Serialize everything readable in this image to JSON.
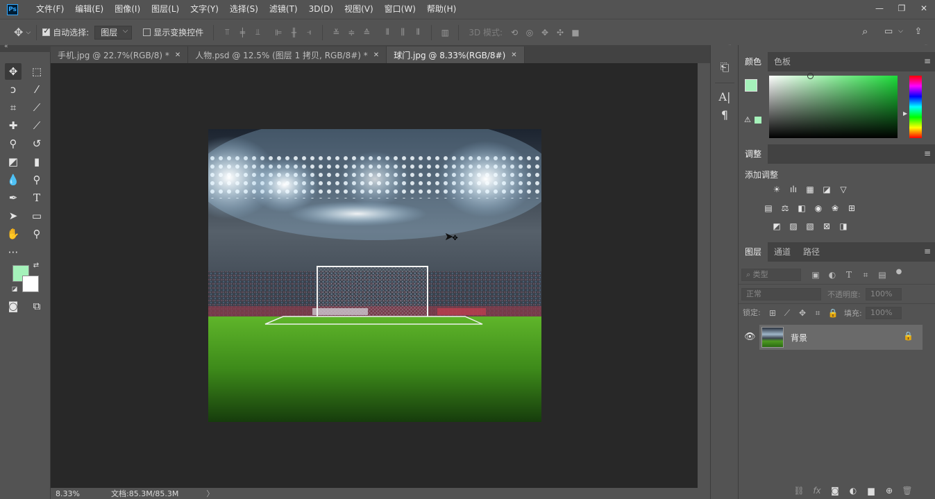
{
  "app": {
    "logo_text": "Ps",
    "menu": [
      "文件(F)",
      "编辑(E)",
      "图像(I)",
      "图层(L)",
      "文字(Y)",
      "选择(S)",
      "滤镜(T)",
      "3D(D)",
      "视图(V)",
      "窗口(W)",
      "帮助(H)"
    ],
    "window_controls": [
      "minimize-icon",
      "restore-icon",
      "close-icon"
    ]
  },
  "options": {
    "auto_select_label": "自动选择:",
    "auto_select_checked": true,
    "auto_select_target": "图层",
    "show_transform_label": "显示变换控件",
    "show_transform_checked": false,
    "mode_3d_label": "3D 模式:"
  },
  "tabs": [
    {
      "label": "手机.jpg @ 22.7%(RGB/8) *",
      "active": false
    },
    {
      "label": "人物.psd @ 12.5% (图层 1 拷贝, RGB/8#) *",
      "active": false
    },
    {
      "label": "球门.jpg @ 8.33%(RGB/8#)",
      "active": true
    }
  ],
  "status": {
    "zoom": "8.33%",
    "doc_size": "文档:85.3M/85.3M",
    "arrow": "〉"
  },
  "colors": {
    "foreground": "#a5f2ba",
    "background": "#ffffff"
  },
  "color_panel": {
    "tabs": [
      "颜色",
      "色板"
    ],
    "active_tab": "颜色"
  },
  "adjust_panel": {
    "tab": "调整",
    "title": "添加调整"
  },
  "layers_panel": {
    "tabs": [
      "图层",
      "通道",
      "路径"
    ],
    "active_tab": "图层",
    "filter_label": "类型",
    "blend_mode": "正常",
    "opacity_label": "不透明度:",
    "opacity_value": "100%",
    "lock_label": "锁定:",
    "fill_label": "填充:",
    "fill_value": "100%",
    "layers": [
      {
        "name": "背景",
        "visible": true,
        "locked": true
      }
    ]
  }
}
